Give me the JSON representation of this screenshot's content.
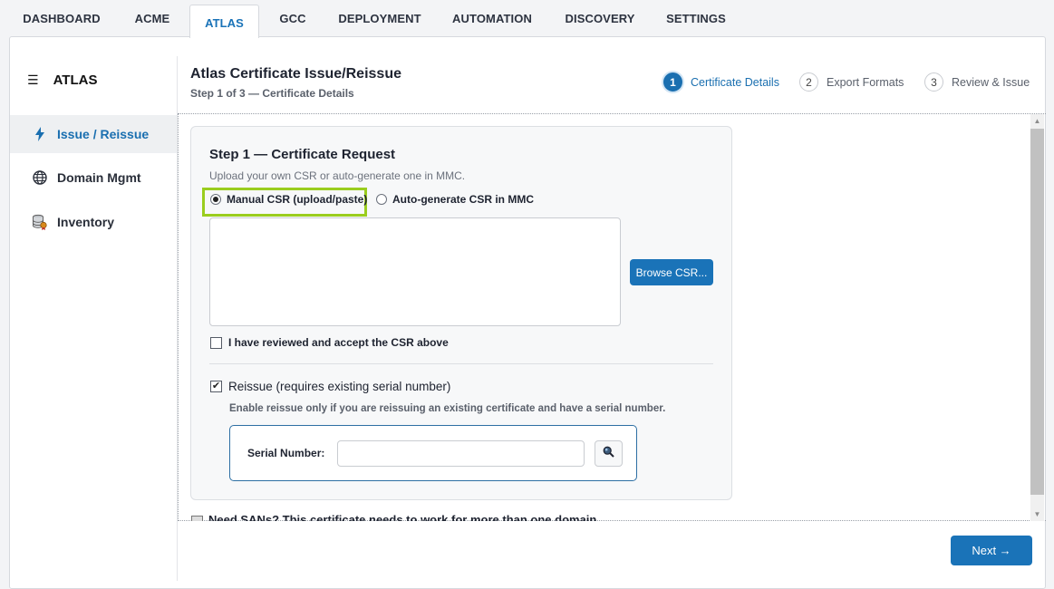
{
  "top_tabs": [
    "DASHBOARD",
    "ACME",
    "ATLAS",
    "GCC",
    "DEPLOYMENT",
    "AUTOMATION",
    "DISCOVERY",
    "SETTINGS"
  ],
  "active_tab": "ATLAS",
  "sidebar": {
    "title": "ATLAS",
    "menu_icon": "hamburger-icon",
    "items": [
      {
        "label": "Issue / Reissue",
        "icon": "lightning-icon",
        "active": true
      },
      {
        "label": "Domain Mgmt",
        "icon": "globe-icon",
        "active": false
      },
      {
        "label": "Inventory",
        "icon": "database-certificate-icon",
        "active": false
      }
    ]
  },
  "header": {
    "title": "Atlas Certificate Issue/Reissue",
    "subtitle": "Step 1 of 3 — Certificate Details"
  },
  "steps": [
    {
      "num": "1",
      "label": "Certificate Details",
      "active": true
    },
    {
      "num": "2",
      "label": "Export Formats",
      "active": false
    },
    {
      "num": "3",
      "label": "Review & Issue",
      "active": false
    }
  ],
  "form": {
    "title": "Step 1 — Certificate Request",
    "subtitle": "Upload your own CSR or auto-generate one in MMC.",
    "radio_manual": "Manual CSR (upload/paste)",
    "radio_auto": "Auto-generate CSR in MMC",
    "selected_mode": "manual",
    "csr_value": "",
    "browse_label": "Browse CSR...",
    "accept_label": "I have reviewed and accept the CSR above",
    "accept_checked": false,
    "reissue_label": "Reissue (requires existing serial number)",
    "reissue_checked": true,
    "reissue_note": "Enable reissue only if you are reissuing an existing certificate and have a serial number.",
    "serial_label": "Serial Number:",
    "serial_value": "",
    "lookup_icon": "search-icon",
    "sans_label": "Need SANs? This certificate needs to work for more than one domain"
  },
  "footer": {
    "next_label": "Next →"
  },
  "colors": {
    "accent": "#1a73b8",
    "highlight": "#9acd1e"
  }
}
